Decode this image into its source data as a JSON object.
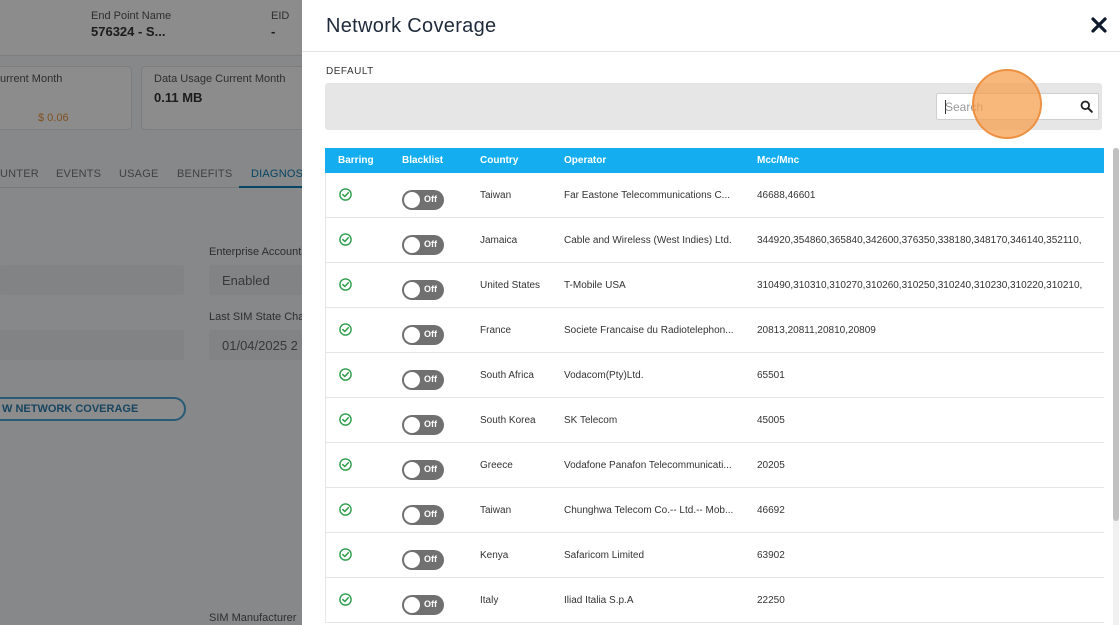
{
  "background": {
    "end_point_label": "End Point Name",
    "end_point_value": "576324 - S...",
    "eid_label": "EID",
    "eid_value": "-",
    "usage_month_label": "urrent Month",
    "usage_month_value": "$ 0.06",
    "data_usage_label": "Data Usage Current Month",
    "data_usage_value": "0.11 MB",
    "tabs": [
      "UNTER",
      "EVENTS",
      "USAGE",
      "BENEFITS",
      "DIAGNOS"
    ],
    "enterprise_label": "Enterprise Account S",
    "enterprise_value": "Enabled",
    "sim_state_label": "Last SIM State Chang",
    "sim_state_value": "01/04/2025 2",
    "view_coverage_button": "W NETWORK COVERAGE",
    "sim_manufacturer_label": "SIM Manufacturer"
  },
  "modal": {
    "title": "Network Coverage",
    "section_label": "DEFAULT",
    "search_placeholder": "Search",
    "columns": [
      "Barring",
      "Blacklist",
      "Country",
      "Operator",
      "Mcc/Mnc"
    ],
    "rows": [
      {
        "country": "Taiwan",
        "operator": "Far Eastone Telecommunications C...",
        "mccmnc": "46688,46601",
        "blacklist": "Off"
      },
      {
        "country": "Jamaica",
        "operator": "Cable and Wireless (West Indies) Ltd.",
        "mccmnc": "344920,354860,365840,342600,376350,338180,348170,346140,352110,",
        "blacklist": "Off"
      },
      {
        "country": "United States",
        "operator": "T-Mobile USA",
        "mccmnc": "310490,310310,310270,310260,310250,310240,310230,310220,310210,",
        "blacklist": "Off"
      },
      {
        "country": "France",
        "operator": "Societe Francaise du Radiotelephon...",
        "mccmnc": "20813,20811,20810,20809",
        "blacklist": "Off"
      },
      {
        "country": "South Africa",
        "operator": "Vodacom(Pty)Ltd.",
        "mccmnc": "65501",
        "blacklist": "Off"
      },
      {
        "country": "South Korea",
        "operator": "SK Telecom",
        "mccmnc": "45005",
        "blacklist": "Off"
      },
      {
        "country": "Greece",
        "operator": "Vodafone Panafon Telecommunicati...",
        "mccmnc": "20205",
        "blacklist": "Off"
      },
      {
        "country": "Taiwan",
        "operator": "Chunghwa Telecom Co.-- Ltd.-- Mob...",
        "mccmnc": "46692",
        "blacklist": "Off"
      },
      {
        "country": "Kenya",
        "operator": "Safaricom Limited",
        "mccmnc": "63902",
        "blacklist": "Off"
      },
      {
        "country": "Italy",
        "operator": "Iliad Italia S.p.A",
        "mccmnc": "22250",
        "blacklist": "Off"
      }
    ]
  },
  "colors": {
    "header_bg": "#14aef0",
    "check_green": "#2e9e4a",
    "toggle_off": "#707070"
  },
  "icons": {
    "close": "close-icon",
    "search": "search-icon",
    "barring": "check-circle-icon"
  }
}
